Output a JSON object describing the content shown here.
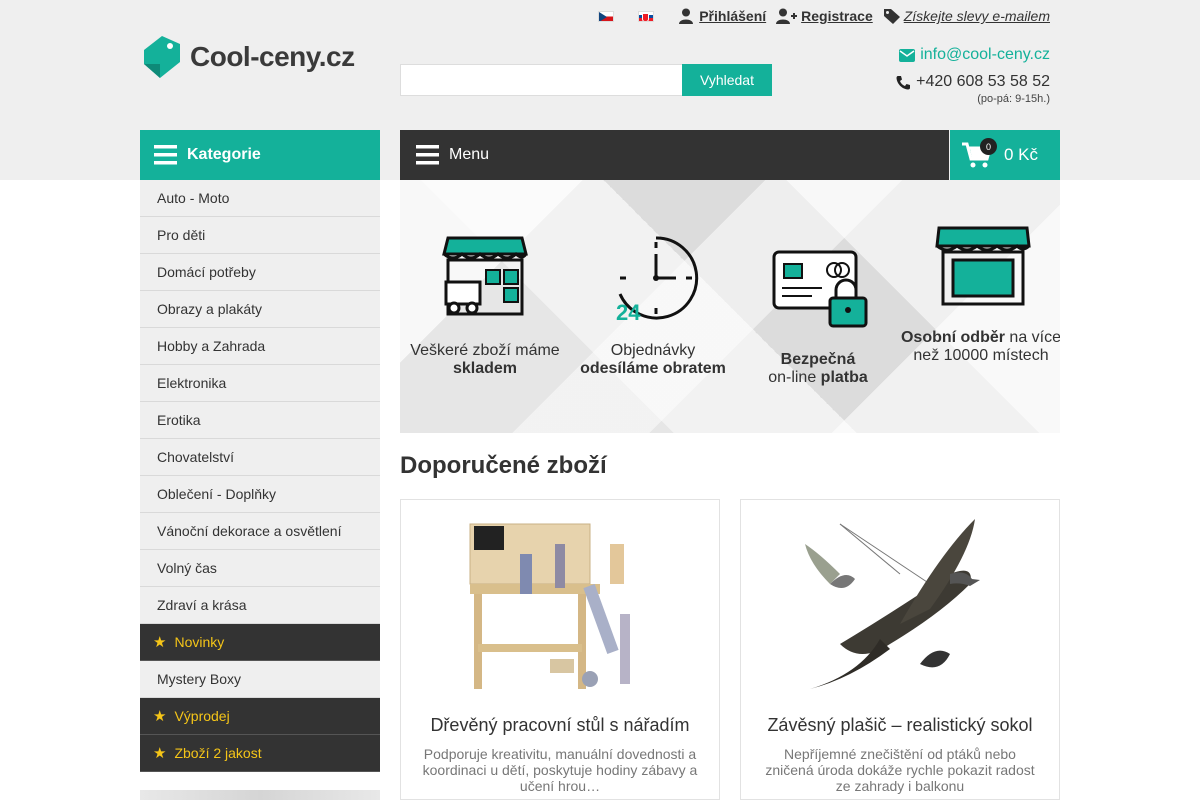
{
  "header": {
    "languages": [
      "cs",
      "sk"
    ],
    "login_label": "Přihlášení",
    "register_label": "Registrace",
    "discounts_label": "Získejte slevy e-mailem",
    "logo_text": "Cool-ceny.cz",
    "search": {
      "placeholder": "",
      "button_label": "Vyhledat"
    },
    "email": "info@cool-ceny.cz",
    "phone": "+420 608 53 58 52",
    "hours": "(po-pá: 9-15h.)"
  },
  "nav": {
    "categories_label": "Kategorie",
    "menu_label": "Menu",
    "cart_count": "0",
    "cart_total": "0 Kč"
  },
  "categories": [
    "Auto - Moto",
    "Pro děti",
    "Domácí potřeby",
    "Obrazy a plakáty",
    "Hobby a Zahrada",
    "Elektronika",
    "Erotika",
    "Chovatelství",
    "Oblečení - Doplňky",
    "Vánoční dekorace a osvětlení",
    "Volný čas",
    "Zdraví a krása"
  ],
  "special": {
    "novinky": "Novinky",
    "mystery": "Mystery Boxy",
    "vyprodej": "Výprodej",
    "zbozi2": "Zboží 2 jakost"
  },
  "features": [
    {
      "pre": "Veškeré zboží máme",
      "bold": "skladem",
      "post": ""
    },
    {
      "pre": "Objednávky",
      "bold": "odesíláme obratem",
      "post": ""
    },
    {
      "bold1": "Bezpečná",
      "mid": "on-line",
      "bold2": "platba"
    },
    {
      "bold": "Osobní odběr",
      "post": "na více než 10000 místech"
    }
  ],
  "recommended": {
    "title": "Doporučené zboží",
    "products": [
      {
        "name": "Dřevěný pracovní stůl s nářadím",
        "desc": "Podporuje kreativitu, manuální dovednosti a koordinaci u dětí, poskytuje hodiny zábavy a učení hrou…"
      },
      {
        "name": "Závěsný plašič – realistický sokol",
        "desc": "Nepříjemné znečištění od ptáků nebo zničená úroda dokáže rychle pokazit radost ze zahrady i balkonu"
      }
    ]
  },
  "colors": {
    "accent": "#14b19a",
    "dark": "#333333",
    "star": "#f5c518",
    "band": "#efefef"
  }
}
